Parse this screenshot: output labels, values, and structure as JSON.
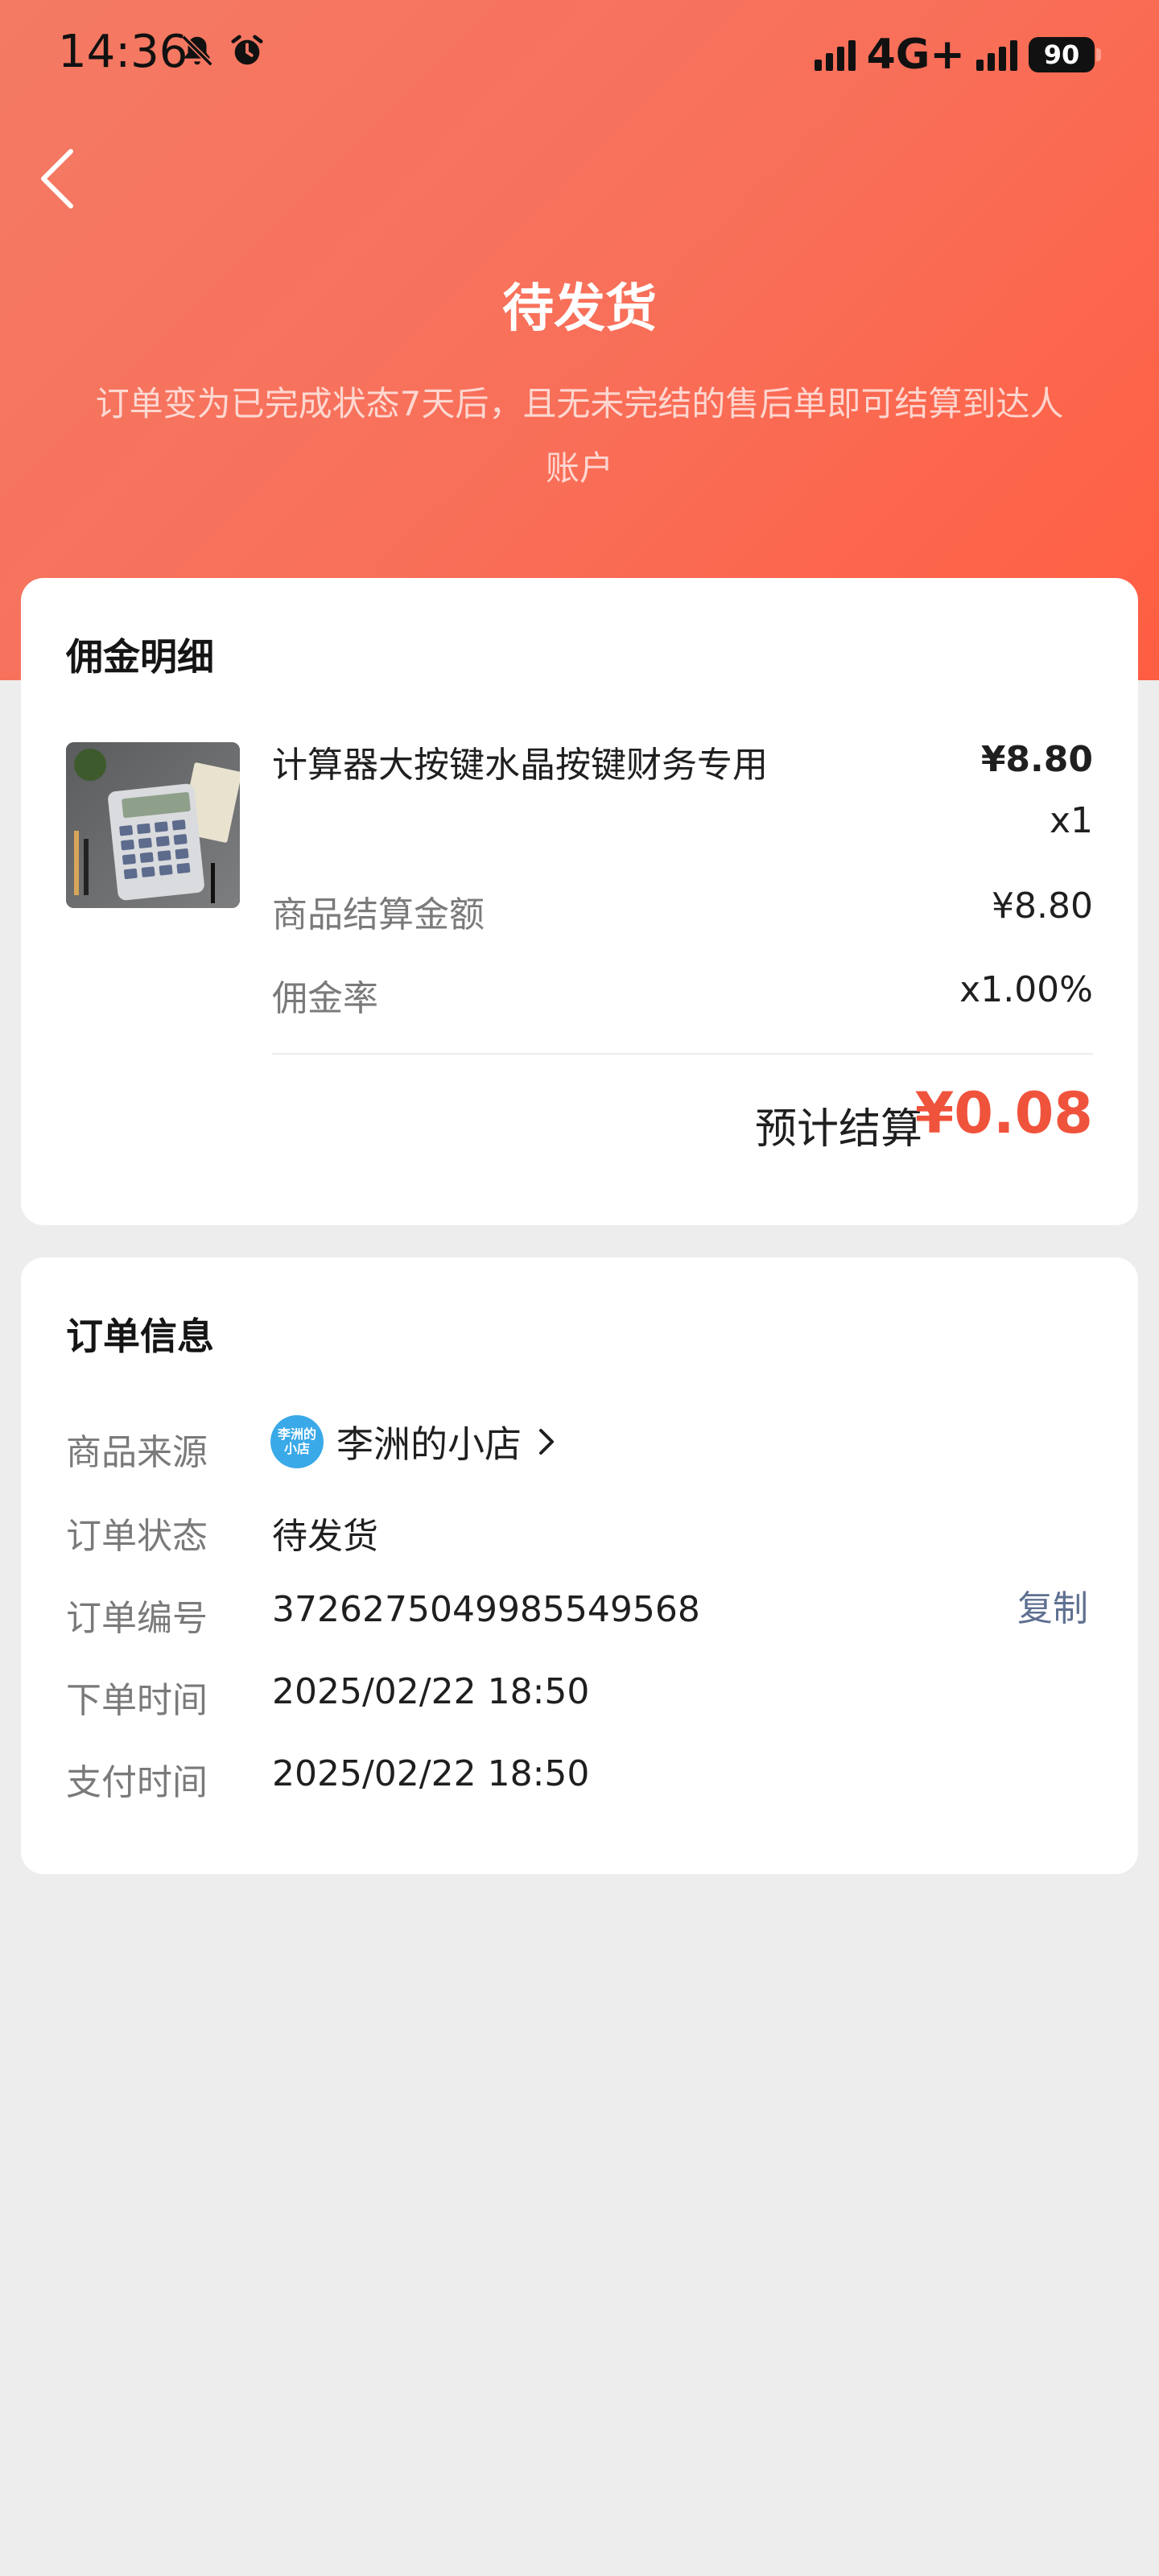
{
  "status_bar": {
    "time": "14:36",
    "icons": [
      "bell-off-icon",
      "alarm-icon"
    ],
    "network": "4G+",
    "battery": "90"
  },
  "header": {
    "title": "待发货",
    "description": "订单变为已完成状态7天后，且无未完结的售后单即可结算到达人账户",
    "back_icon": "chevron-left-icon"
  },
  "commission": {
    "title": "佣金明细",
    "product": {
      "name": "计算器大按键水晶按键财务专用",
      "price": "¥8.80",
      "quantity": "x1"
    },
    "rows": [
      {
        "label": "商品结算金额",
        "value": "¥8.80"
      },
      {
        "label": "佣金率",
        "value": "x1.00%"
      }
    ],
    "estimate_label": "预计结算",
    "estimate_value": "¥0.08"
  },
  "order_info": {
    "title": "订单信息",
    "source_label": "商品来源",
    "shop_avatar_text": "李洲的小店",
    "shop_name": "李洲的小店",
    "status_label": "订单状态",
    "status_value": "待发货",
    "order_no_label": "订单编号",
    "order_no_value": "3726275049985549568",
    "copy_label": "复制",
    "order_time_label": "下单时间",
    "order_time_value": "2025/02/22 18:50",
    "pay_time_label": "支付时间",
    "pay_time_value": "2025/02/22 18:50"
  },
  "colors": {
    "header_start": "#f47a64",
    "header_end": "#ff5e42",
    "accent": "#f0533c",
    "link": "#5f7091"
  }
}
